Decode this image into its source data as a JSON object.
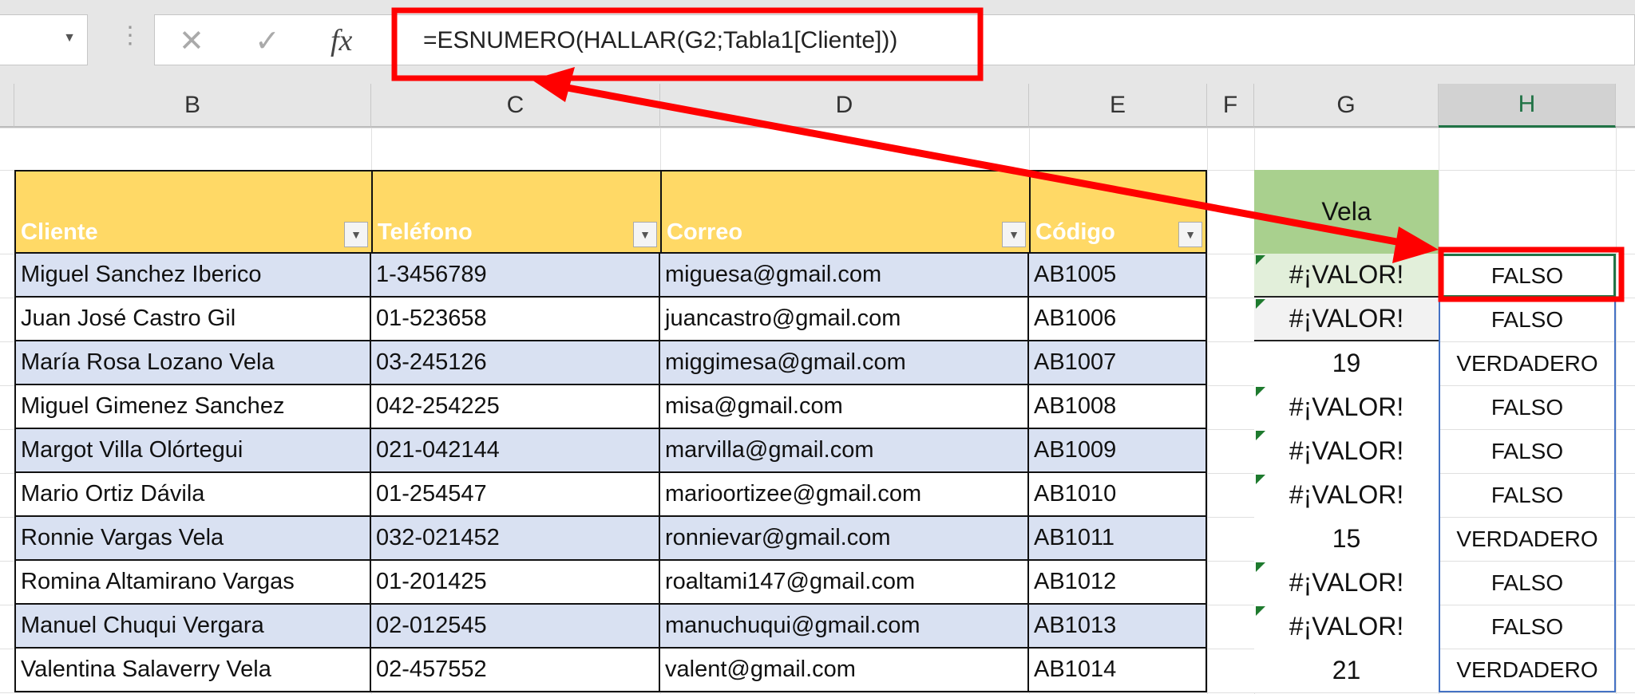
{
  "formula_bar": {
    "formula": "=ESNUMERO(HALLAR(G2;Tabla1[Cliente]))",
    "cancel_icon": "close-icon",
    "enter_icon": "check-icon",
    "function_icon": "fx-icon"
  },
  "columns": [
    "B",
    "C",
    "D",
    "E",
    "F",
    "G",
    "H"
  ],
  "table": {
    "headers": [
      "Cliente",
      "Teléfono",
      "Correo",
      "Código"
    ],
    "rows": [
      [
        "Miguel Sanchez Iberico",
        "1-3456789",
        "miguesa@gmail.com",
        "AB1005"
      ],
      [
        "Juan José Castro Gil",
        "01-523658",
        "juancastro@gmail.com",
        "AB1006"
      ],
      [
        "María Rosa Lozano Vela",
        "03-245126",
        "miggimesa@gmail.com",
        "AB1007"
      ],
      [
        "Miguel Gimenez Sanchez",
        "042-254225",
        "misa@gmail.com",
        "AB1008"
      ],
      [
        "Margot Villa Olórtegui",
        "021-042144",
        "marvilla@gmail.com",
        "AB1009"
      ],
      [
        "Mario Ortiz Dávila",
        "01-254547",
        "marioortizee@gmail.com",
        "AB1010"
      ],
      [
        "Ronnie Vargas Vela",
        "032-021452",
        "ronnievar@gmail.com",
        "AB1011"
      ],
      [
        "Romina Altamirano Vargas",
        "01-201425",
        "roaltami147@gmail.com",
        "AB1012"
      ],
      [
        "Manuel Chuqui Vergara",
        "02-012545",
        "manuchuqui@gmail.com",
        "AB1013"
      ],
      [
        "Valentina Salaverry Vela",
        "02-457552",
        "valent@gmail.com",
        "AB1014"
      ]
    ]
  },
  "search": {
    "header": "Vela",
    "results": [
      "#¡VALOR!",
      "#¡VALOR!",
      "19",
      "#¡VALOR!",
      "#¡VALOR!",
      "#¡VALOR!",
      "15",
      "#¡VALOR!",
      "#¡VALOR!",
      "21"
    ]
  },
  "check": {
    "results": [
      "FALSO",
      "FALSO",
      "VERDADERO",
      "FALSO",
      "FALSO",
      "FALSO",
      "VERDADERO",
      "FALSO",
      "FALSO",
      "VERDADERO"
    ]
  },
  "colors": {
    "header_fill": "#ffd966",
    "band_fill": "#d9e1f2",
    "vela_fill": "#a9d08e",
    "annotation": "#ff0000",
    "selection": "#217346"
  }
}
